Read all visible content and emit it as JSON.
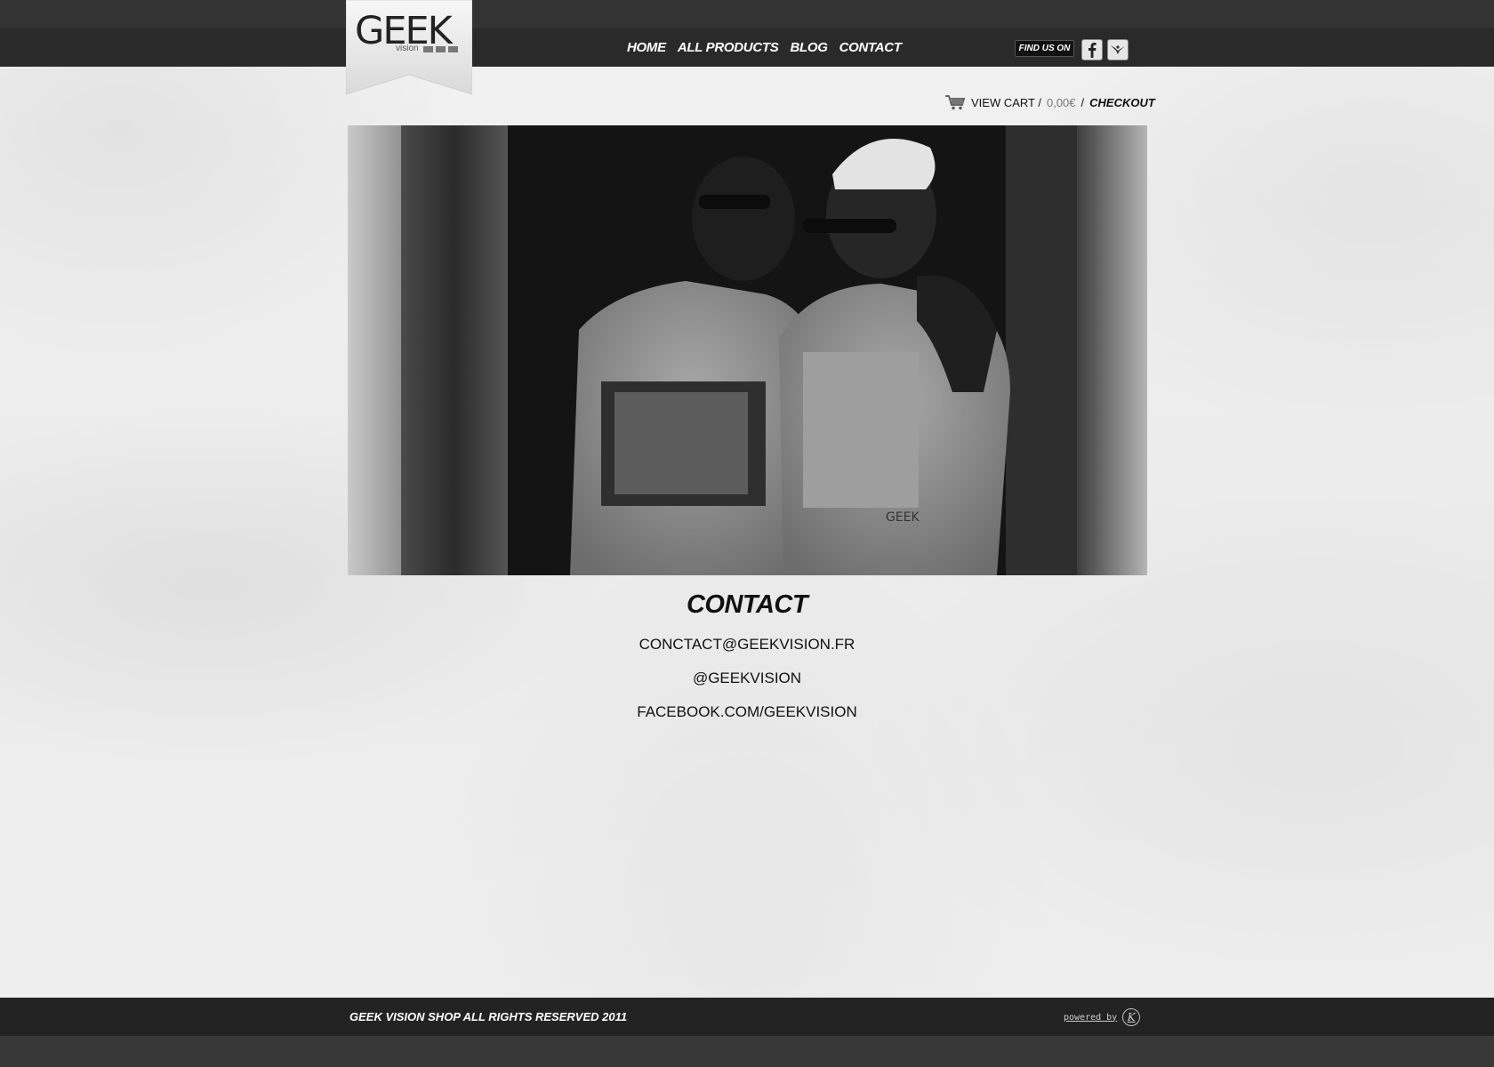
{
  "brand": {
    "logo_text": "GEEK",
    "logo_sub": "vision"
  },
  "nav": {
    "items": [
      {
        "label": "HOME"
      },
      {
        "label": "ALL PRODUCTS"
      },
      {
        "label": "BLOG"
      },
      {
        "label": "CONTACT"
      }
    ]
  },
  "social": {
    "find_us_label": "FIND US ON",
    "icons": [
      "facebook-icon",
      "twitter-icon"
    ]
  },
  "cart": {
    "view_cart_label": "VIEW CART /",
    "total": "0,00€",
    "separator": "/",
    "checkout_label": "CHECKOUT"
  },
  "hero": {
    "shirt_print_text": "GEEK"
  },
  "contact": {
    "title": "CONTACT",
    "email": "CONCTACT@GEEKVISION.FR",
    "twitter": "@GEEKVISION",
    "facebook": "FACEBOOK.COM/GEEKVISION"
  },
  "footer": {
    "copyright": "GEEK VISION SHOP ALL RIGHTS RESERVED 2011",
    "powered_by": "powered by",
    "powered_mark": "K"
  },
  "colors": {
    "bar_dark": "#2a2a2a",
    "top_strip": "#333333",
    "page_bg": "#efefef",
    "text": "#111111"
  }
}
